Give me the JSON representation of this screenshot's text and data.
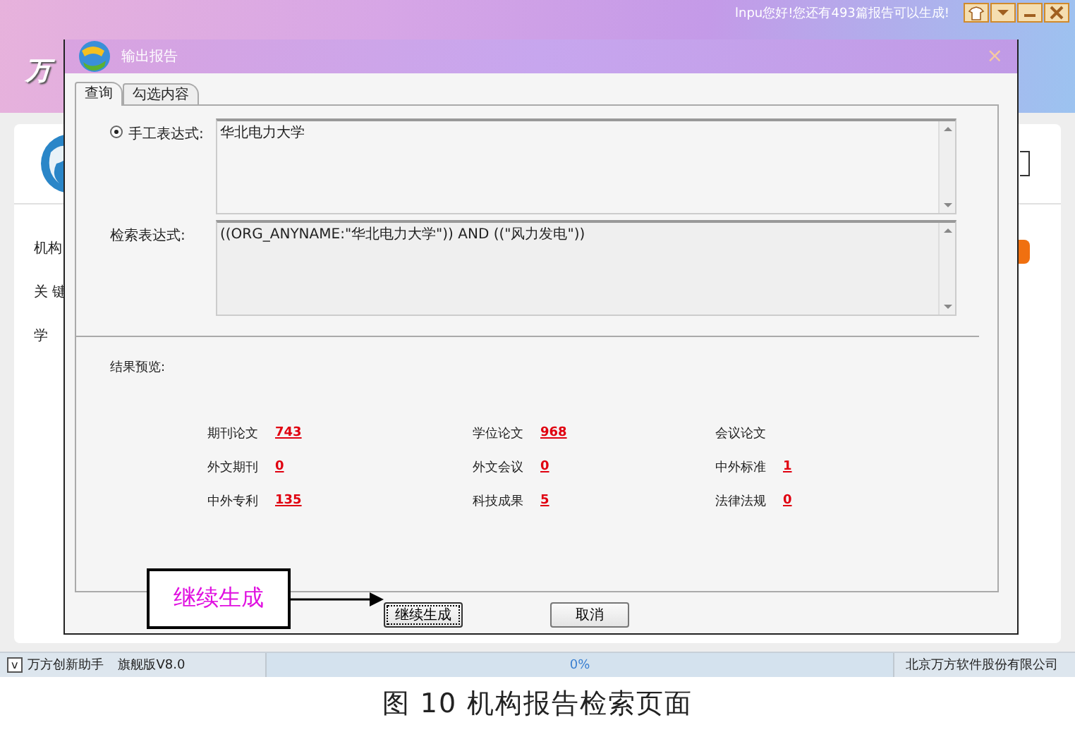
{
  "app": {
    "greeting": "lnpu您好!您还有493篇报告可以生成!",
    "logo": "万",
    "side_labels": [
      "机构",
      "关 键",
      "学"
    ]
  },
  "dialog": {
    "title": "输出报告",
    "close": "×",
    "tabs": [
      {
        "label": "查询",
        "selected": true
      },
      {
        "label": "勾选内容",
        "selected": false
      }
    ],
    "manual": {
      "label": "手工表达式:",
      "selected": true,
      "value": "华北电力大学"
    },
    "search": {
      "label": "检索表达式:",
      "value": "((ORG_ANYNAME:\"华北电力大学\")) AND ((\"风力发电\"))"
    },
    "preview_label": "结果预览:",
    "results": [
      {
        "label": "期刊论文",
        "count": "743"
      },
      {
        "label": "学位论文",
        "count": "968"
      },
      {
        "label": "会议论文"
      },
      {
        "label": "外文期刊",
        "count": "0"
      },
      {
        "label": "外文会议",
        "count": "0"
      },
      {
        "label": "中外标准",
        "count": "1"
      },
      {
        "label": "中外专利",
        "count": "135"
      },
      {
        "label": "科技成果",
        "count": "5"
      },
      {
        "label": "法律法规",
        "count": "0"
      }
    ],
    "buttons": [
      {
        "label": "继续生成",
        "focused": true
      },
      {
        "label": "取消",
        "focused": false
      }
    ],
    "callout": "继续生成"
  },
  "status_bar": {
    "toggle": "v",
    "app_name": "万方创新助手",
    "edition": "旗舰版V8.0",
    "progress": "0%",
    "company": "北京万方软件股份有限公司"
  },
  "caption": "图 10 机构报告检索页面"
}
